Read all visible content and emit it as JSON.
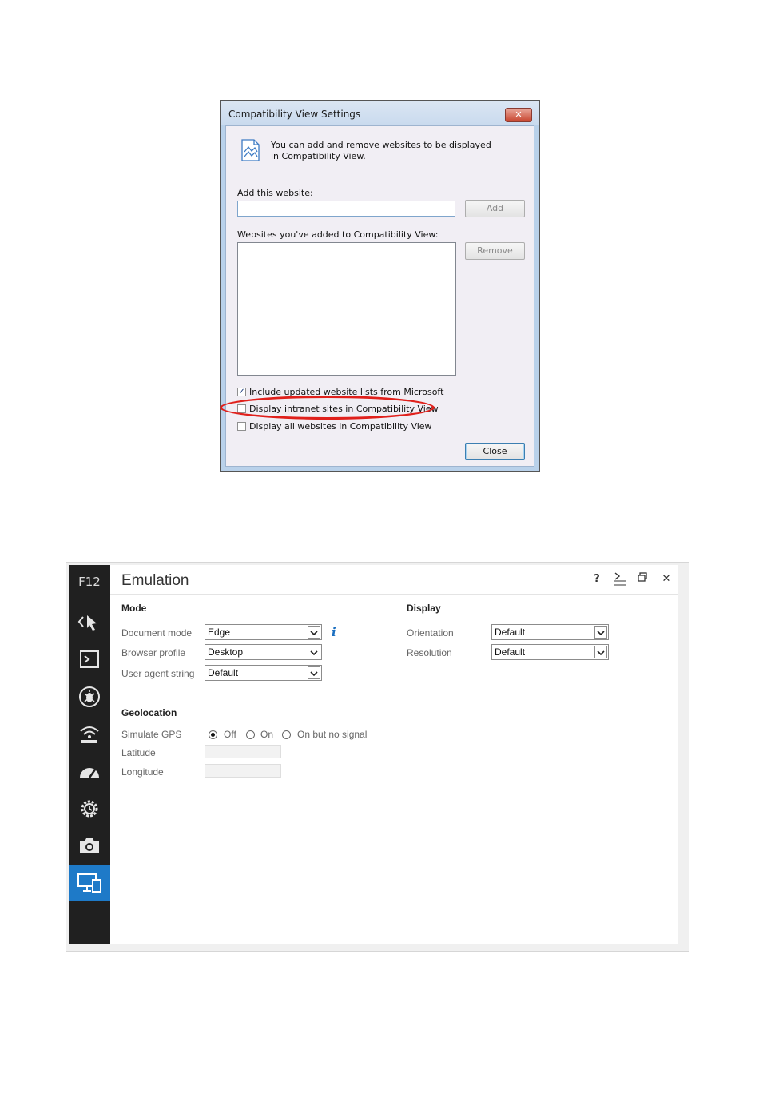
{
  "compat_dialog": {
    "title": "Compatibility View Settings",
    "close_glyph": "✕",
    "info_text": "You can add and remove websites to be displayed in Compatibility View.",
    "add_label": "Add this website:",
    "add_input_value": "",
    "add_button": "Add",
    "list_label": "Websites you've added to Compatibility View:",
    "remove_button": "Remove",
    "checkboxes": [
      {
        "label": "Include updated website lists from Microsoft",
        "checked": true
      },
      {
        "label": "Display intranet sites in Compatibility View",
        "checked": false
      },
      {
        "label": "Display all websites in Compatibility View",
        "checked": false
      }
    ],
    "close_button": "Close",
    "highlight_color": "#e0201b"
  },
  "devtools": {
    "sidebar_label": "F12",
    "tools": [
      "dom-explorer-icon",
      "console-icon",
      "debugger-icon",
      "network-icon",
      "performance-icon",
      "memory-icon",
      "screenshot-icon",
      "emulation-icon"
    ],
    "active_tool": "emulation-icon",
    "accent": "#1e7ac8",
    "panel_title": "Emulation",
    "header_buttons": {
      "help": "?",
      "close": "✕"
    },
    "mode": {
      "heading": "Mode",
      "document_mode_label": "Document mode",
      "document_mode_value": "Edge",
      "browser_profile_label": "Browser profile",
      "browser_profile_value": "Desktop",
      "user_agent_label": "User agent string",
      "user_agent_value": "Default",
      "info_glyph": "i"
    },
    "display": {
      "heading": "Display",
      "orientation_label": "Orientation",
      "orientation_value": "Default",
      "resolution_label": "Resolution",
      "resolution_value": "Default"
    },
    "geolocation": {
      "heading": "Geolocation",
      "simulate_gps_label": "Simulate GPS",
      "options": [
        "Off",
        "On",
        "On but no signal"
      ],
      "selected": "Off",
      "latitude_label": "Latitude",
      "longitude_label": "Longitude"
    }
  }
}
